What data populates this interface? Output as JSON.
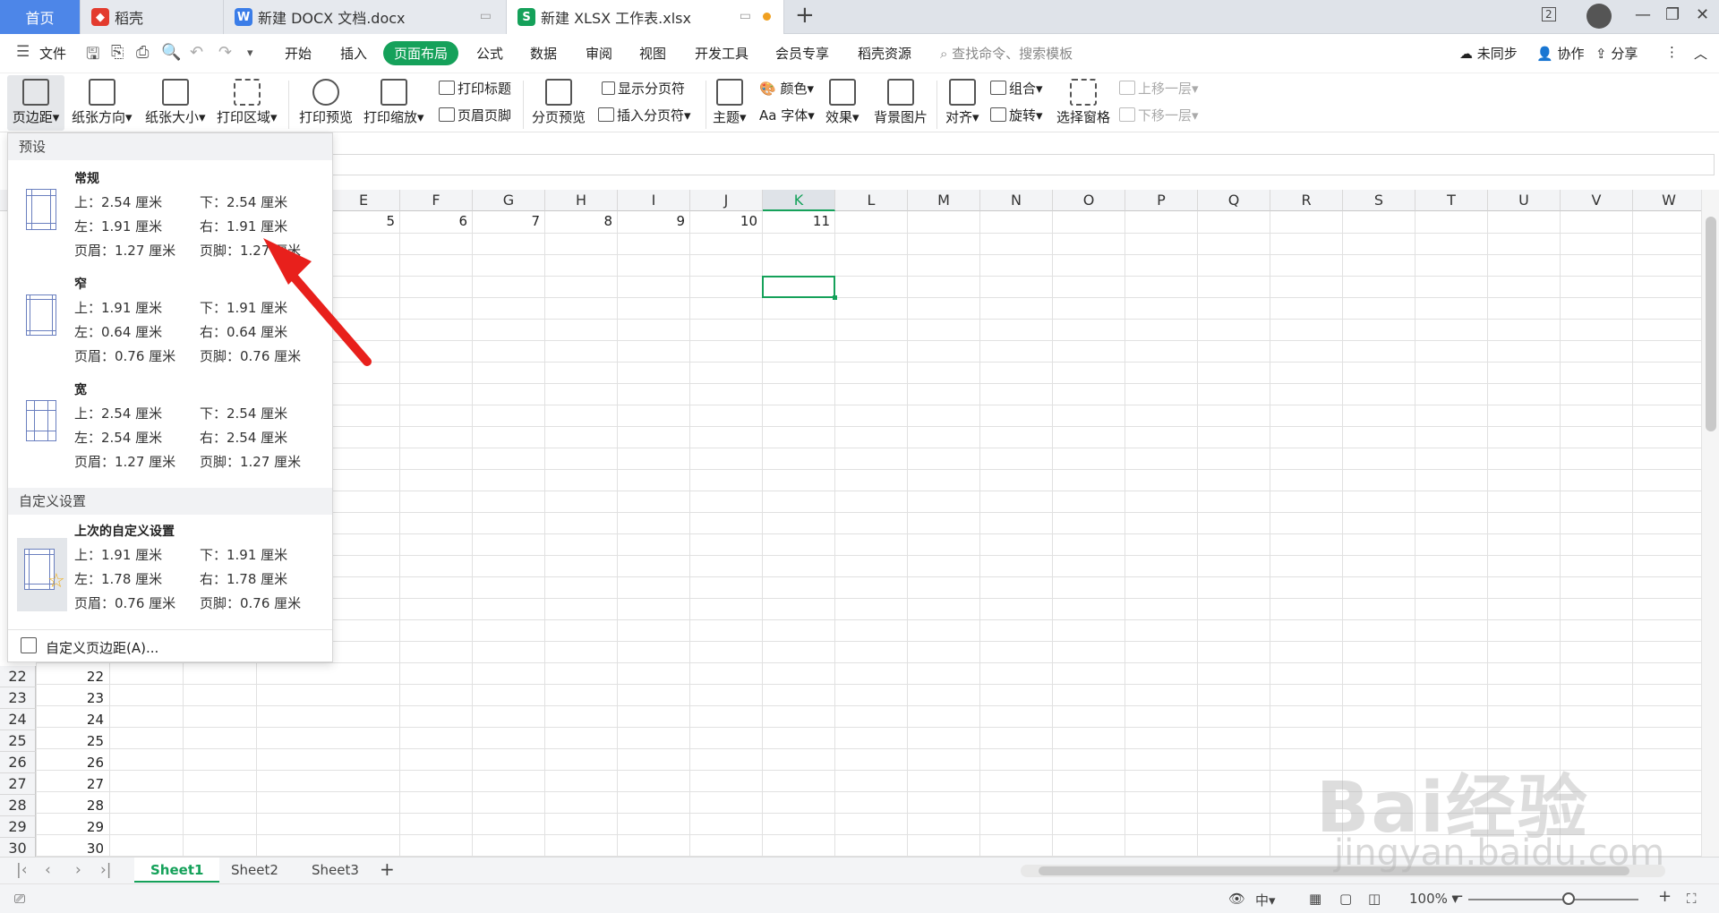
{
  "tabs": [
    {
      "label": "首页"
    },
    {
      "label": "稻壳"
    },
    {
      "label": "新建 DOCX 文档.docx"
    },
    {
      "label": "新建 XLSX 工作表.xlsx"
    }
  ],
  "titlebar": {
    "badge": "2"
  },
  "menu": {
    "file": "文件",
    "items": [
      "开始",
      "插入",
      "页面布局",
      "公式",
      "数据",
      "审阅",
      "视图",
      "开发工具",
      "会员专享",
      "稻壳资源"
    ],
    "active": "页面布局",
    "search_placeholder": "查找命令、搜索模板",
    "right": [
      "未同步",
      "协作",
      "分享"
    ]
  },
  "ribbon": {
    "margins": "页边距",
    "orientation": "纸张方向",
    "size": "纸张大小",
    "print_area": "打印区域",
    "print_preview": "打印预览",
    "print_scale": "打印缩放",
    "print_titles": "打印标题",
    "header_footer": "页眉页脚",
    "page_break_preview": "分页预览",
    "show_page_breaks": "显示分页符",
    "insert_page_break": "插入分页符",
    "theme": "主题",
    "colors": "颜色",
    "fonts": "字体",
    "effects": "效果",
    "bg_image": "背景图片",
    "align": "对齐",
    "group": "组合",
    "rotate": "旋转",
    "selection_pane": "选择窗格",
    "bring_forward": "上移一层",
    "send_backward": "下移一层"
  },
  "columns": [
    "E",
    "F",
    "G",
    "H",
    "I",
    "J",
    "K",
    "L",
    "M",
    "N",
    "O",
    "P",
    "Q",
    "R",
    "S",
    "T",
    "U",
    "V",
    "W"
  ],
  "selected_column": "K",
  "row1_values": [
    "5",
    "6",
    "7",
    "8",
    "9",
    "10",
    "11"
  ],
  "visible_rows": [
    {
      "num": "22",
      "val": "22"
    },
    {
      "num": "23",
      "val": "23"
    },
    {
      "num": "24",
      "val": "24"
    },
    {
      "num": "25",
      "val": "25"
    },
    {
      "num": "26",
      "val": "26"
    },
    {
      "num": "27",
      "val": "27"
    },
    {
      "num": "28",
      "val": "28"
    },
    {
      "num": "29",
      "val": "29"
    },
    {
      "num": "30",
      "val": "30"
    }
  ],
  "dropdown": {
    "section_preset": "预设",
    "section_custom": "自定义设置",
    "presets": [
      {
        "name": "常规",
        "top": "上：2.54 厘米",
        "bottom": "下：2.54 厘米",
        "left": "左：1.91 厘米",
        "right": "右：1.91 厘米",
        "header": "页眉：1.27 厘米",
        "footer": "页脚：1.27 厘米"
      },
      {
        "name": "窄",
        "top": "上：1.91 厘米",
        "bottom": "下：1.91 厘米",
        "left": "左：0.64 厘米",
        "right": "右：0.64 厘米",
        "header": "页眉：0.76 厘米",
        "footer": "页脚：0.76 厘米"
      },
      {
        "name": "宽",
        "top": "上：2.54 厘米",
        "bottom": "下：2.54 厘米",
        "left": "左：2.54 厘米",
        "right": "右：2.54 厘米",
        "header": "页眉：1.27 厘米",
        "footer": "页脚：1.27 厘米"
      }
    ],
    "custom": {
      "name": "上次的自定义设置",
      "top": "上：1.91 厘米",
      "bottom": "下：1.91 厘米",
      "left": "左：1.78 厘米",
      "right": "右：1.78 厘米",
      "header": "页眉：0.76 厘米",
      "footer": "页脚：0.76 厘米"
    },
    "custom_link": "自定义页边距(A)..."
  },
  "sheets": [
    "Sheet1",
    "Sheet2",
    "Sheet3"
  ],
  "active_sheet": "Sheet1",
  "status": {
    "zoom": "100%"
  },
  "watermark": {
    "brand": "Bai经验",
    "url": "jingyan.baidu.com"
  },
  "colors": {
    "accent": "#15a15a",
    "home_tab": "#4d86e8",
    "arrow": "#e8201c"
  }
}
